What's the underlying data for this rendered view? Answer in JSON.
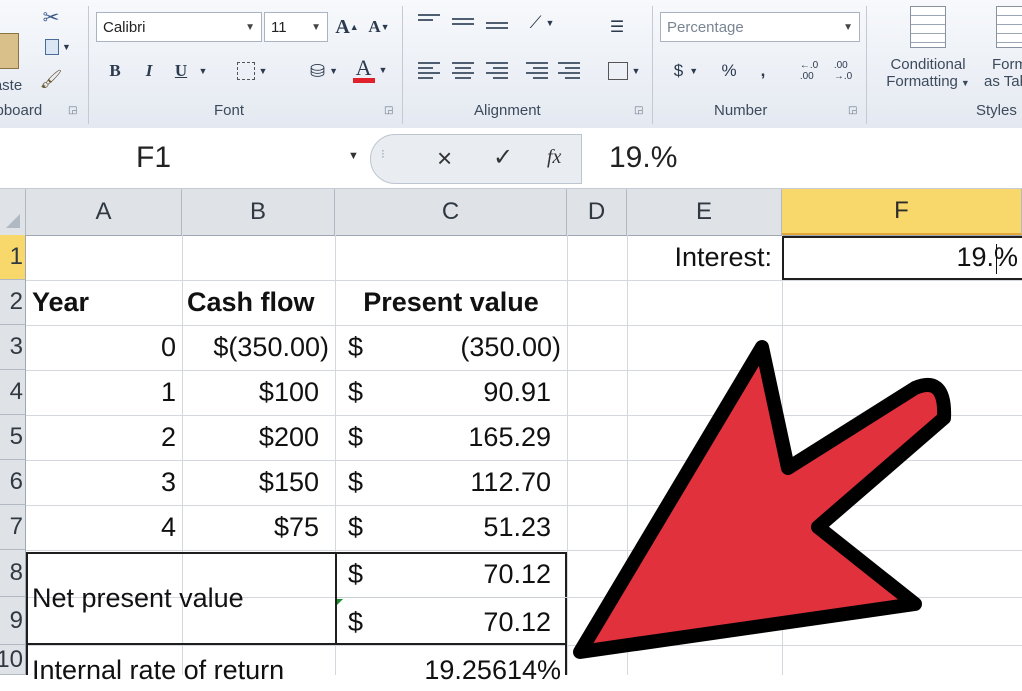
{
  "ribbon": {
    "clipboard": {
      "paste_label": "Paste",
      "group_label": "Clipboard"
    },
    "font": {
      "group_label": "Font",
      "font_name": "Calibri",
      "font_size": "11",
      "bold": "B",
      "italic": "I",
      "underline": "U",
      "grow": "A",
      "shrink": "A",
      "font_color": "A"
    },
    "alignment": {
      "group_label": "Alignment"
    },
    "number": {
      "group_label": "Number",
      "format": "Percentage",
      "currency": "$",
      "percent": "%",
      "comma": ",",
      "inc_decimal": "←.0\n.00",
      "dec_decimal": ".00\n→.0"
    },
    "styles": {
      "group_label": "Styles",
      "conditional_line1": "Conditional",
      "conditional_line2": "Formatting",
      "format_table_line1": "Format",
      "format_table_line2": "as Table"
    }
  },
  "formula_bar": {
    "name_box": "F1",
    "cancel": "×",
    "enter": "✓",
    "fx": "fx",
    "formula": "19.%"
  },
  "columns": [
    "A",
    "B",
    "C",
    "D",
    "E",
    "F"
  ],
  "selected_column": "F",
  "rows": [
    "1",
    "2",
    "3",
    "4",
    "5",
    "6",
    "7",
    "8",
    "9",
    "10"
  ],
  "cells": {
    "E1": "Interest:",
    "F1": "19.%",
    "A2": "Year",
    "B2": "Cash flow",
    "C2": "Present value",
    "A3": "0",
    "B3": "$(350.00)",
    "C3_sym": "$",
    "C3": "(350.00)",
    "A4": "1",
    "B4": "$100",
    "C4_sym": "$",
    "C4": "90.91",
    "A5": "2",
    "B5": "$200",
    "C5_sym": "$",
    "C5": "165.29",
    "A6": "3",
    "B6": "$150",
    "C6_sym": "$",
    "C6": "112.70",
    "A7": "4",
    "B7": "$75",
    "C7_sym": "$",
    "C7": "51.23",
    "A8": "Net present value",
    "C8_sym": "$",
    "C8": "70.12",
    "C9_sym": "$",
    "C9": "70.12",
    "A10": "Internal rate of return",
    "C10": "19.25614%"
  },
  "colors": {
    "arrow_fill": "#e0313c",
    "selected_header": "#f9d86b",
    "ribbon_bg": "#e9edf3"
  }
}
